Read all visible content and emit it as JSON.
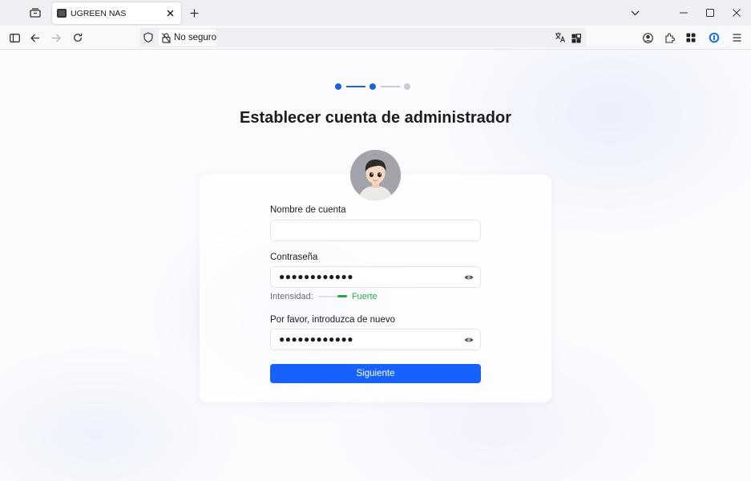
{
  "browser": {
    "tab": {
      "title": "UGREEN NAS"
    },
    "urlbar": {
      "security_text": "No seguro"
    },
    "icons": {
      "tab_list": "tab-list-icon",
      "sidebar": "sidebar-icon",
      "back": "back-arrow-icon",
      "forward": "forward-arrow-icon",
      "reload": "reload-icon",
      "shield": "shield-icon",
      "not_secure": "not-secure-lock-icon",
      "translate": "translate-icon",
      "qr": "qr-code-icon",
      "account": "account-icon",
      "extensions": "extensions-icon",
      "grid": "grid-icon",
      "password_manager": "password-manager-icon",
      "menu": "hamburger-menu-icon"
    }
  },
  "setup": {
    "steps": {
      "total": 3,
      "current": 2
    },
    "title": "Establecer cuenta de administrador",
    "fields": {
      "account_label": "Nombre de cuenta",
      "account_value": "",
      "password_label": "Contraseña",
      "password_value": "●●●●●●●●●●●●",
      "strength_label": "Intensidad:",
      "strength_value": "Fuerte",
      "strength_level": 1.0,
      "confirm_label": "Por favor, introduzca de nuevo",
      "confirm_value": "●●●●●●●●●●●●"
    },
    "next_button": "Siguiente"
  },
  "colors": {
    "accent": "#1761ff",
    "step_active": "#1565d8",
    "step_inactive": "#c9cbd3",
    "strength_strong": "#27a844"
  }
}
